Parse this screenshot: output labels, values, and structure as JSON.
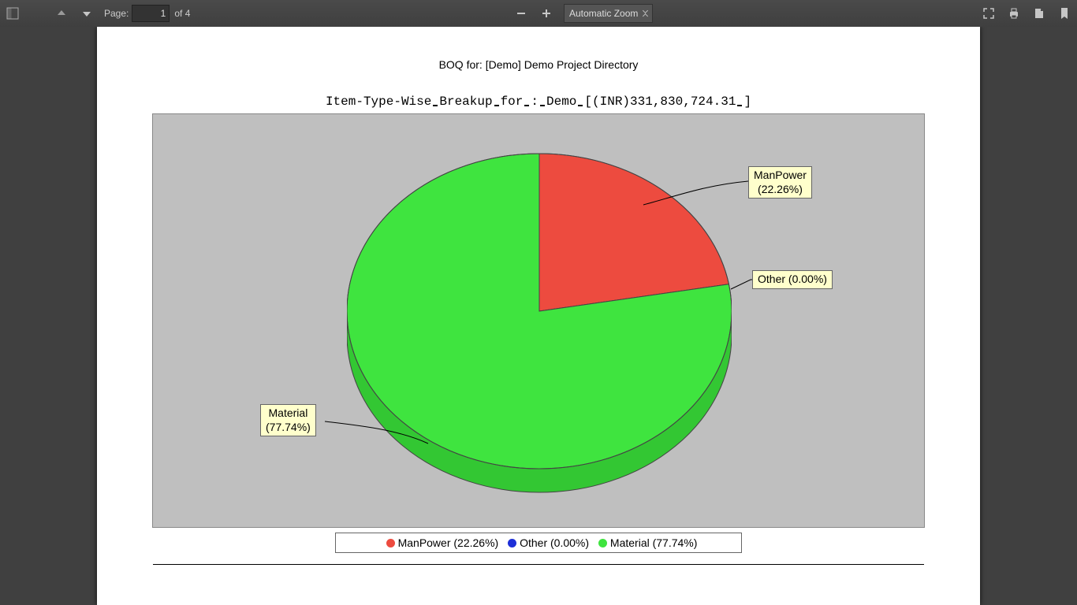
{
  "toolbar": {
    "page_label": "Page:",
    "page_current": "1",
    "page_of": "of 4",
    "zoom_label": "Automatic Zoom"
  },
  "doc": {
    "title": "BOQ for: [Demo] Demo Project Directory"
  },
  "chart_data": {
    "type": "pie",
    "title": "Item-Type-Wise Breakup for : Demo [(INR)331,830,724.31 ]",
    "series": [
      {
        "name": "ManPower",
        "value": 22.26,
        "color": "#ed4b3f"
      },
      {
        "name": "Other",
        "value": 0.0,
        "color": "#1e2fd8"
      },
      {
        "name": "Material",
        "value": 77.74,
        "color": "#3fe43f"
      }
    ],
    "labels": {
      "manpower": "ManPower\n(22.26%)",
      "other": "Other (0.00%)",
      "material": "Material\n(77.74%)"
    },
    "legend": [
      "ManPower (22.26%)",
      "Other (0.00%)",
      "Material (77.74%)"
    ]
  }
}
